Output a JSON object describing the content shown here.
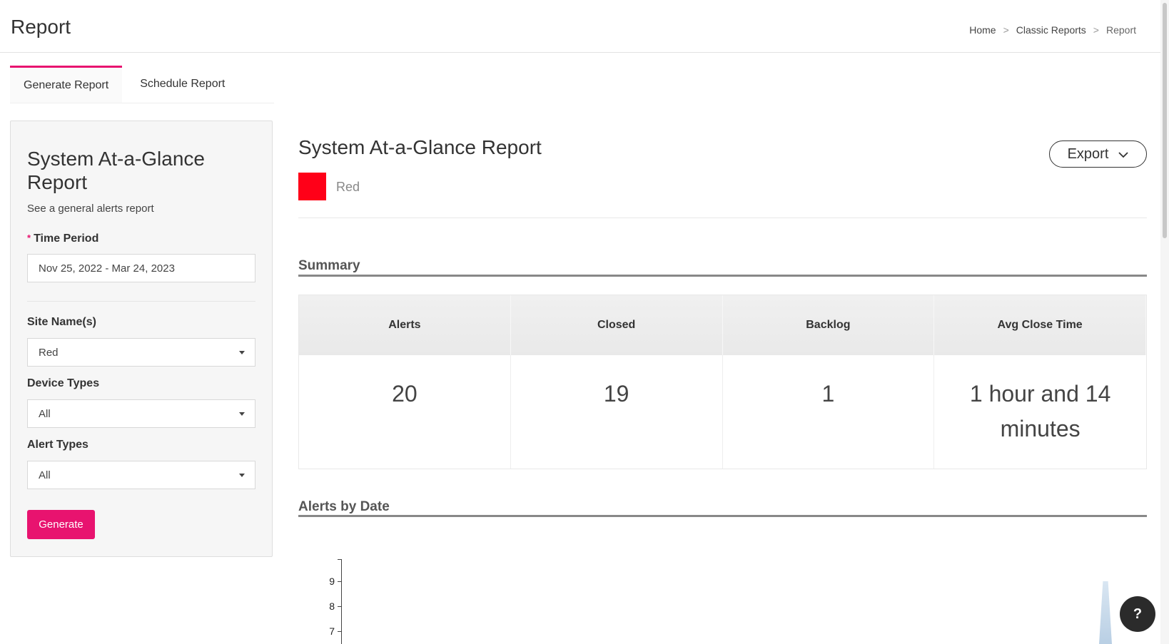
{
  "header": {
    "title": "Report",
    "breadcrumb": {
      "home": "Home",
      "separator": ">",
      "classic_reports": "Classic Reports",
      "current": "Report"
    }
  },
  "tabs": [
    {
      "label": "Generate Report",
      "active": true
    },
    {
      "label": "Schedule Report",
      "active": false
    }
  ],
  "sidebar": {
    "title": "System At-a-Glance Report",
    "subtitle": "See a general alerts report",
    "required_mark": "*",
    "time_period": {
      "label": "Time Period",
      "value": "Nov 25, 2022 - Mar 24, 2023"
    },
    "site_names": {
      "label": "Site Name(s)",
      "value": "Red"
    },
    "device_types": {
      "label": "Device Types",
      "value": "All"
    },
    "alert_types": {
      "label": "Alert Types",
      "value": "All"
    },
    "generate_label": "Generate"
  },
  "report": {
    "title": "System At-a-Glance Report",
    "site_label": "Red",
    "site_color": "#ff0018",
    "export_label": "Export",
    "summary": {
      "title": "Summary",
      "columns": [
        "Alerts",
        "Closed",
        "Backlog",
        "Avg Close Time"
      ],
      "values": [
        "20",
        "19",
        "1",
        "1 hour and 14 minutes"
      ]
    },
    "alerts_by_date": {
      "title": "Alerts by Date",
      "y_ticks": [
        "9",
        "8",
        "7"
      ]
    }
  },
  "help": {
    "label": "?"
  },
  "colors": {
    "accent": "#e8136f",
    "help_button": "#2b2b2b"
  }
}
